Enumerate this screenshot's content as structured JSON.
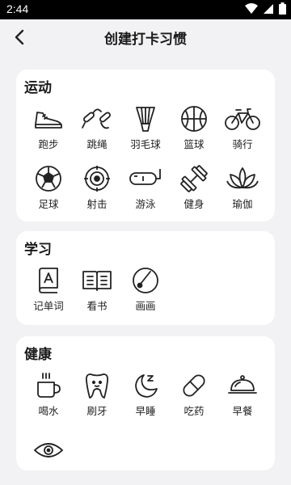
{
  "status_bar": {
    "time": "2:44"
  },
  "header": {
    "title": "创建打卡习惯"
  },
  "sections": [
    {
      "title": "运动",
      "items": [
        {
          "label": "跑步",
          "icon": "sneaker-icon"
        },
        {
          "label": "跳绳",
          "icon": "jump-rope-icon"
        },
        {
          "label": "羽毛球",
          "icon": "shuttlecock-icon"
        },
        {
          "label": "篮球",
          "icon": "basketball-icon"
        },
        {
          "label": "骑行",
          "icon": "bicycle-icon"
        },
        {
          "label": "足球",
          "icon": "soccer-ball-icon"
        },
        {
          "label": "射击",
          "icon": "target-icon"
        },
        {
          "label": "游泳",
          "icon": "swim-goggles-icon"
        },
        {
          "label": "健身",
          "icon": "dumbbell-icon"
        },
        {
          "label": "瑜伽",
          "icon": "lotus-icon"
        }
      ]
    },
    {
      "title": "学习",
      "items": [
        {
          "label": "记单词",
          "icon": "vocabulary-book-icon"
        },
        {
          "label": "看书",
          "icon": "open-book-icon"
        },
        {
          "label": "画画",
          "icon": "palette-icon"
        }
      ]
    },
    {
      "title": "健康",
      "items": [
        {
          "label": "喝水",
          "icon": "cup-icon"
        },
        {
          "label": "刷牙",
          "icon": "tooth-icon"
        },
        {
          "label": "早睡",
          "icon": "moon-sleep-icon"
        },
        {
          "label": "吃药",
          "icon": "pill-icon"
        },
        {
          "label": "早餐",
          "icon": "food-cloche-icon"
        },
        {
          "label": "",
          "icon": "eye-icon"
        }
      ]
    }
  ]
}
